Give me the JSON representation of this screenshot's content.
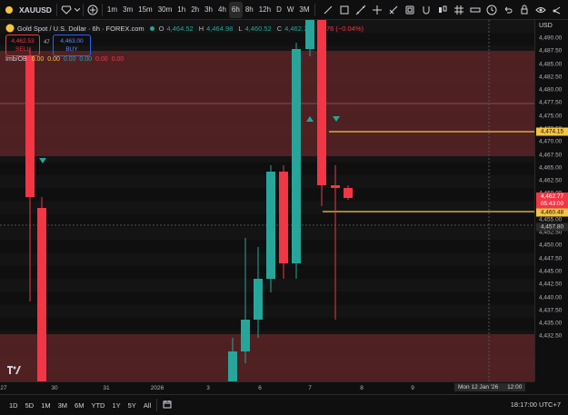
{
  "symbol": "XAUUSD",
  "toolbar": {
    "timeframes": [
      "1m",
      "3m",
      "15m",
      "30m",
      "1h",
      "2h",
      "3h",
      "4h",
      "6h",
      "8h",
      "12h",
      "D",
      "W",
      "3M"
    ],
    "active_timeframe": "6h",
    "right_icons": [
      "brush-icon",
      "square-icon",
      "line-icon",
      "crosshair-icon",
      "measure-icon",
      "frame-icon",
      "magnet-icon",
      "candles-icon",
      "grid-icon",
      "ruler-icon",
      "clock-icon",
      "undo-icon",
      "lock-icon",
      "eye-icon",
      "share-icon"
    ]
  },
  "legend": {
    "title": "Gold Spot / U.S. Dollar · 6h · FOREX.com",
    "o_label": "O",
    "o_value": "4,464.52",
    "h_label": "H",
    "h_value": "4,464.98",
    "l_label": "L",
    "l_value": "4,460.52",
    "c_label": "C",
    "c_value": "4,462.77",
    "change": "−1.76 (−0.04%)"
  },
  "trade": {
    "sell_price": "4,462.53",
    "sell_label": "SELL",
    "spread": "47",
    "buy_price": "4,463.00",
    "buy_label": "BUY"
  },
  "indicator": {
    "name": "Imb/OB",
    "values": [
      "0.00",
      "0.00",
      "0.00",
      "0.00",
      "0.00",
      "0.00"
    ]
  },
  "price_axis": {
    "currency": "USD",
    "ticks": [
      "4,490.00",
      "4,487.50",
      "4,485.00",
      "4,482.50",
      "4,480.00",
      "4,477.50",
      "4,475.00",
      "4,472.50",
      "4,470.00",
      "4,467.50",
      "4,465.00",
      "4,462.50",
      "4,460.00",
      "4,457.50",
      "4,455.00",
      "4,452.50",
      "4,450.00",
      "4,447.50",
      "4,445.00",
      "4,442.50",
      "4,440.00",
      "4,437.50",
      "4,435.00",
      "4,432.50"
    ],
    "tag_level_upper": "4,474.15",
    "tag_last_price": "4,462.77",
    "tag_countdown": "05:43:00",
    "tag_level_lower": "4,460.48",
    "tag_crosshair": "4,457.80"
  },
  "time_axis": {
    "ticks": [
      "27",
      "30",
      "31",
      "2026",
      "3",
      "6",
      "7",
      "8",
      "9"
    ],
    "cursor_label": "Mon 12 Jan '26",
    "cursor_time": "12:00"
  },
  "bottom_bar": {
    "ranges": [
      "1D",
      "5D",
      "1M",
      "3M",
      "6M",
      "YTD",
      "1Y",
      "5Y",
      "All"
    ],
    "clock": "18:17:00 UTC+7"
  },
  "colors": {
    "up": "#26a69a",
    "down": "#f23645",
    "zone": "#5a2326",
    "level": "#f5c542",
    "background": "#0f0f0f"
  }
}
